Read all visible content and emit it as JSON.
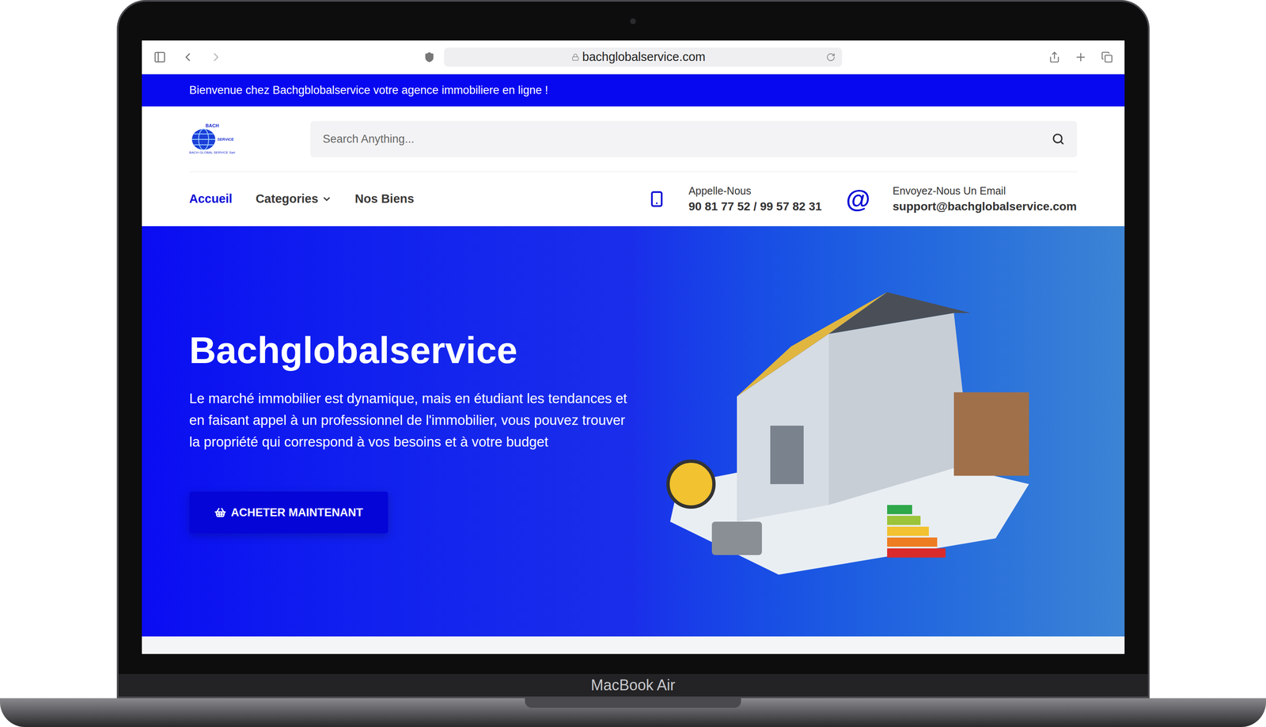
{
  "device": {
    "label": "MacBook Air"
  },
  "browser": {
    "url": "bachglobalservice.com"
  },
  "banner": {
    "text": "Bienvenue chez Bachgblobalservice votre agence immobiliere en ligne !"
  },
  "logo": {
    "top": "BACH",
    "side": "SERVICE",
    "bottom": "BACH GLOBAL SERVICE Sarl"
  },
  "search": {
    "placeholder": "Search Anything..."
  },
  "nav": [
    {
      "label": "Accueil",
      "selected": true,
      "dropdown": false
    },
    {
      "label": "Categories",
      "selected": false,
      "dropdown": true
    },
    {
      "label": "Nos Biens",
      "selected": false,
      "dropdown": false
    }
  ],
  "contacts": [
    {
      "kind": "phone",
      "label": "Appelle-Nous",
      "value": "90 81 77 52 / 99 57 82 31"
    },
    {
      "kind": "email",
      "icon": "@",
      "label": "Envoyez-Nous Un Email",
      "value": "support@bachglobalservice.com"
    }
  ],
  "hero": {
    "title": "Bachglobalservice",
    "text": "Le marché immobilier est dynamique, mais en étudiant les tendances et en faisant appel à un professionnel de l'immobilier, vous pouvez trouver la propriété qui correspond à vos besoins et à votre budget",
    "button": "ACHETER MAINTENANT"
  }
}
